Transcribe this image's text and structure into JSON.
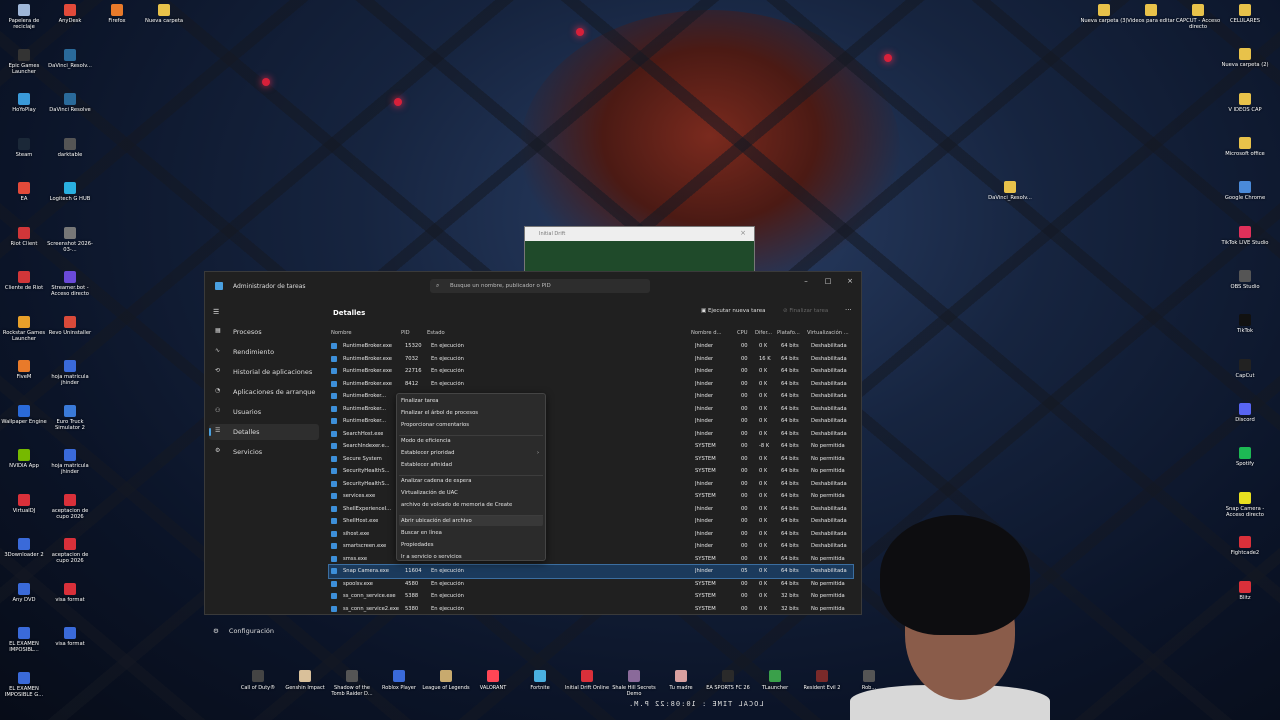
{
  "desktop": {
    "left_icons": [
      {
        "label": "Papelera de reciclaje",
        "color": "#9fb7d9"
      },
      {
        "label": "AnyDesk",
        "color": "#e24a3a"
      },
      {
        "label": "Firefox",
        "color": "#e87a2a"
      },
      {
        "label": "Nueva carpeta",
        "color": "#e8c24a"
      },
      {
        "label": "Epic Games Launcher",
        "color": "#333333"
      },
      {
        "label": "DaVinci_Resolv...",
        "color": "#2a6a9a"
      },
      {
        "label": "HoYoPlay",
        "color": "#3a9ad9"
      },
      {
        "label": "DaVinci Resolve",
        "color": "#2a6a9a"
      },
      {
        "label": "Steam",
        "color": "#1b2838"
      },
      {
        "label": "darktable",
        "color": "#555555"
      },
      {
        "label": "EA",
        "color": "#e24a3a"
      },
      {
        "label": "Logitech G HUB",
        "color": "#2ab0e0"
      },
      {
        "label": "Riot Client",
        "color": "#d13639"
      },
      {
        "label": "Screenshot 2026-03-...",
        "color": "#777777"
      },
      {
        "label": "Cliente de Riot",
        "color": "#d13639"
      },
      {
        "label": "Streamer.bot - Acceso directo",
        "color": "#6a4ad9"
      },
      {
        "label": "Rockstar Games Launcher",
        "color": "#e8a02a"
      },
      {
        "label": "Revo Uninstaller",
        "color": "#d94a3a"
      },
      {
        "label": "FiveM",
        "color": "#e87a2a"
      },
      {
        "label": "hoja matricula jhinder",
        "color": "#3a6ad9"
      },
      {
        "label": "Wallpaper Engine",
        "color": "#2a6ad9"
      },
      {
        "label": "Euro Truck Simulator 2",
        "color": "#3a7ad9"
      },
      {
        "label": "NVIDIA App",
        "color": "#76b900"
      },
      {
        "label": "hoja matricula jhinder",
        "color": "#3a6ad9"
      },
      {
        "label": "VirtualDJ",
        "color": "#d9303a"
      },
      {
        "label": "aceptacion de cupo 2026",
        "color": "#d9303a"
      },
      {
        "label": "3Downloader 2",
        "color": "#3a6ad9"
      },
      {
        "label": "aceptacion de cupo 2026",
        "color": "#d9303a"
      },
      {
        "label": "Any DVD",
        "color": "#3a6ad9"
      },
      {
        "label": "visa format",
        "color": "#d9303a"
      },
      {
        "label": "EL EXAMEN IMPOSIBL...",
        "color": "#3a6ad9"
      },
      {
        "label": "visa format",
        "color": "#3a6ad9"
      },
      {
        "label": "EL EXAMEN IMPOSIBLE G...",
        "color": "#3a6ad9"
      }
    ],
    "right_icons": [
      {
        "label": "Nueva carpeta (3)",
        "color": "#e8c24a"
      },
      {
        "label": "Videos para editar",
        "color": "#e8c24a"
      },
      {
        "label": "CAPCUT - Acceso directo",
        "color": "#e8c24a"
      },
      {
        "label": "CELULARES",
        "color": "#e8c24a"
      },
      {
        "label": "Nueva carpeta (2)",
        "color": "#e8c24a"
      },
      {
        "label": "V IDEOS CAP",
        "color": "#e8c24a"
      },
      {
        "label": "Microsoft office",
        "color": "#e8c24a"
      },
      {
        "label": "DaVinci_Resolv...",
        "color": "#e8c24a"
      },
      {
        "label": "Google Chrome",
        "color": "#4a8ad9"
      },
      {
        "label": "TikTok LIVE Studio",
        "color": "#e0305a"
      },
      {
        "label": "OBS Studio",
        "color": "#555555"
      },
      {
        "label": "TikTok",
        "color": "#111111"
      },
      {
        "label": "CapCut",
        "color": "#222222"
      },
      {
        "label": "Discord",
        "color": "#5865f2"
      },
      {
        "label": "Spotify",
        "color": "#1db954"
      },
      {
        "label": "Snap Camera - Acceso directo",
        "color": "#e8e020"
      },
      {
        "label": "Fightcade2",
        "color": "#d9303a"
      },
      {
        "label": "Blitz",
        "color": "#d9303a"
      }
    ]
  },
  "drift_window": {
    "title": "Initial Drift"
  },
  "task_manager": {
    "title": "Administrador de tareas",
    "search_placeholder": "Busque un nombre, publicador o PID",
    "section_title": "Detalles",
    "run_new_task": "Ejecutar nueva tarea",
    "end_task": "Finalizar tarea",
    "nav": [
      {
        "label": "Procesos",
        "icon": "grid-icon"
      },
      {
        "label": "Rendimiento",
        "icon": "chart-icon"
      },
      {
        "label": "Historial de aplicaciones",
        "icon": "history-icon"
      },
      {
        "label": "Aplicaciones de arranque",
        "icon": "speed-icon"
      },
      {
        "label": "Usuarios",
        "icon": "users-icon"
      },
      {
        "label": "Detalles",
        "icon": "list-icon"
      },
      {
        "label": "Servicios",
        "icon": "puzzle-icon"
      }
    ],
    "settings_label": "Configuración",
    "columns": [
      "Nombre",
      "PID",
      "Estado",
      "Nombre d...",
      "CPU",
      "Difer...",
      "Platafo...",
      "Virtualización ..."
    ],
    "rows": [
      {
        "name": "RuntimeBroker.exe",
        "pid": "15320",
        "state": "En ejecución",
        "user": "Jhinder",
        "cpu": "00",
        "mem": "0 K",
        "plat": "64 bits",
        "virt": "Deshabilitada"
      },
      {
        "name": "RuntimeBroker.exe",
        "pid": "7032",
        "state": "En ejecución",
        "user": "Jhinder",
        "cpu": "00",
        "mem": "16 K",
        "plat": "64 bits",
        "virt": "Deshabilitada"
      },
      {
        "name": "RuntimeBroker.exe",
        "pid": "22716",
        "state": "En ejecución",
        "user": "Jhinder",
        "cpu": "00",
        "mem": "0 K",
        "plat": "64 bits",
        "virt": "Deshabilitada"
      },
      {
        "name": "RuntimeBroker.exe",
        "pid": "8412",
        "state": "En ejecución",
        "user": "Jhinder",
        "cpu": "00",
        "mem": "0 K",
        "plat": "64 bits",
        "virt": "Deshabilitada"
      },
      {
        "name": "RuntimeBroker...",
        "pid": "",
        "state": "",
        "user": "Jhinder",
        "cpu": "00",
        "mem": "0 K",
        "plat": "64 bits",
        "virt": "Deshabilitada"
      },
      {
        "name": "RuntimeBroker...",
        "pid": "",
        "state": "",
        "user": "Jhinder",
        "cpu": "00",
        "mem": "0 K",
        "plat": "64 bits",
        "virt": "Deshabilitada"
      },
      {
        "name": "RuntimeBroker...",
        "pid": "",
        "state": "",
        "user": "Jhinder",
        "cpu": "00",
        "mem": "0 K",
        "plat": "64 bits",
        "virt": "Deshabilitada"
      },
      {
        "name": "SearchHost.exe",
        "pid": "",
        "state": "",
        "user": "Jhinder",
        "cpu": "00",
        "mem": "0 K",
        "plat": "64 bits",
        "virt": "Deshabilitada"
      },
      {
        "name": "SearchIndexer.e...",
        "pid": "",
        "state": "",
        "user": "SYSTEM",
        "cpu": "00",
        "mem": "-8 K",
        "plat": "64 bits",
        "virt": "No permitida"
      },
      {
        "name": "Secure System",
        "pid": "",
        "state": "",
        "user": "SYSTEM",
        "cpu": "00",
        "mem": "0 K",
        "plat": "64 bits",
        "virt": "No permitida"
      },
      {
        "name": "SecurityHealthS...",
        "pid": "",
        "state": "",
        "user": "SYSTEM",
        "cpu": "00",
        "mem": "0 K",
        "plat": "64 bits",
        "virt": "No permitida"
      },
      {
        "name": "SecurityHealthS...",
        "pid": "",
        "state": "",
        "user": "Jhinder",
        "cpu": "00",
        "mem": "0 K",
        "plat": "64 bits",
        "virt": "Deshabilitada"
      },
      {
        "name": "services.exe",
        "pid": "",
        "state": "",
        "user": "SYSTEM",
        "cpu": "00",
        "mem": "0 K",
        "plat": "64 bits",
        "virt": "No permitida"
      },
      {
        "name": "ShellExperienceI...",
        "pid": "",
        "state": "",
        "user": "Jhinder",
        "cpu": "00",
        "mem": "0 K",
        "plat": "64 bits",
        "virt": "Deshabilitada"
      },
      {
        "name": "ShellHost.exe",
        "pid": "",
        "state": "",
        "user": "Jhinder",
        "cpu": "00",
        "mem": "0 K",
        "plat": "64 bits",
        "virt": "Deshabilitada"
      },
      {
        "name": "sihost.exe",
        "pid": "",
        "state": "",
        "user": "Jhinder",
        "cpu": "00",
        "mem": "0 K",
        "plat": "64 bits",
        "virt": "Deshabilitada"
      },
      {
        "name": "smartscreen.exe",
        "pid": "",
        "state": "",
        "user": "Jhinder",
        "cpu": "00",
        "mem": "0 K",
        "plat": "64 bits",
        "virt": "Deshabilitada"
      },
      {
        "name": "smss.exe",
        "pid": "",
        "state": "",
        "user": "SYSTEM",
        "cpu": "00",
        "mem": "0 K",
        "plat": "64 bits",
        "virt": "No permitida"
      },
      {
        "name": "Snap Camera.exe",
        "pid": "11604",
        "state": "En ejecución",
        "user": "Jhinder",
        "cpu": "05",
        "mem": "0 K",
        "plat": "64 bits",
        "virt": "Deshabilitada",
        "selected": true
      },
      {
        "name": "spoolsv.exe",
        "pid": "4580",
        "state": "En ejecución",
        "user": "SYSTEM",
        "cpu": "00",
        "mem": "0 K",
        "plat": "64 bits",
        "virt": "No permitida"
      },
      {
        "name": "ss_conn_service.exe",
        "pid": "5388",
        "state": "En ejecución",
        "user": "SYSTEM",
        "cpu": "00",
        "mem": "0 K",
        "plat": "32 bits",
        "virt": "No permitida"
      },
      {
        "name": "ss_conn_service2.exe",
        "pid": "5380",
        "state": "En ejecución",
        "user": "SYSTEM",
        "cpu": "00",
        "mem": "0 K",
        "plat": "32 bits",
        "virt": "No permitida"
      }
    ],
    "context_menu": {
      "groups": [
        [
          "Finalizar tarea",
          "Finalizar el árbol de procesos",
          "Proporcionar comentarios"
        ],
        [
          "Modo de eficiencia",
          "Establecer prioridad",
          "Establecer afinidad"
        ],
        [
          "Analizar cadena de espera",
          "Virtualización de UAC",
          "archivo de volcado de memoria de Create"
        ],
        [
          "Abrir ubicación del archivo",
          "Buscar en línea",
          "Propiedades",
          "Ir a servicio o servicios"
        ]
      ]
    }
  },
  "taskbar": [
    {
      "label": "Call of Duty®",
      "color": "#444444"
    },
    {
      "label": "Genshin Impact",
      "color": "#d9c09a"
    },
    {
      "label": "Shadow of the Tomb Raider D...",
      "color": "#555555"
    },
    {
      "label": "Roblox Player",
      "color": "#3a6ad9"
    },
    {
      "label": "League of Legends",
      "color": "#c8aa6e"
    },
    {
      "label": "VALORANT",
      "color": "#ff4655"
    },
    {
      "label": "Fortnite",
      "color": "#4ab0e0"
    },
    {
      "label": "Initial Drift Online",
      "color": "#d9303a"
    },
    {
      "label": "Shale Hill Secrets Demo",
      "color": "#8a6a9a"
    },
    {
      "label": "Tu madre",
      "color": "#d9a0a0"
    },
    {
      "label": "EA SPORTS FC 26",
      "color": "#2a2a2a"
    },
    {
      "label": "TLauncher",
      "color": "#3aa04a"
    },
    {
      "label": "Resident Evil 2",
      "color": "#7a2a2a"
    },
    {
      "label": "Rob...",
      "color": "#555555"
    }
  ],
  "overlay_clock": "LOCAL TIME : 10:08:22 P.M."
}
